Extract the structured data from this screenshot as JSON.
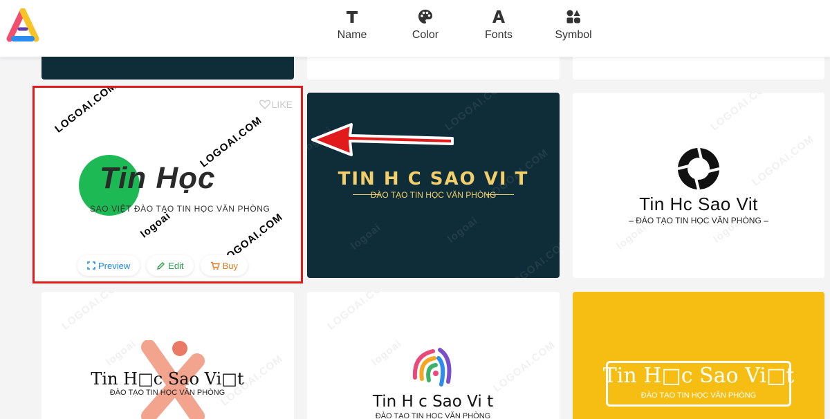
{
  "header": {
    "nav": [
      {
        "label": "Name",
        "icon": "text-icon"
      },
      {
        "label": "Color",
        "icon": "palette-icon"
      },
      {
        "label": "Fonts",
        "icon": "font-icon"
      },
      {
        "label": "Symbol",
        "icon": "shapes-icon"
      }
    ]
  },
  "watermark": {
    "text": "LOGOAI.COM",
    "brand": "logoai"
  },
  "selected_card": {
    "like_label": "LIKE",
    "logo_title": "Tin Học",
    "logo_subtitle": "SAO VIỆT ĐÀO TẠO TIN HỌC VĂN PHÒNG",
    "actions": {
      "preview": "Preview",
      "edit": "Edit",
      "buy": "Buy"
    }
  },
  "dark_card": {
    "title": "TIN H C SAO VI T",
    "subtitle": "ĐÀO TẠO TIN HỌC VĂN PHÒNG"
  },
  "right_card": {
    "title": "Tin Hc Sao Vit",
    "subtitle": "– ĐÀO TẠO TIN HỌC VĂN PHÒNG –"
  },
  "bottom_left": {
    "title": "Tin H□c Sao Vi□t",
    "subtitle": "ĐÀO TẠO TIN HỌC VĂN PHÒNG"
  },
  "bottom_middle": {
    "title": "Tin H  c Sao Vi  t",
    "subtitle": "ĐÀO TẠO TIN HỌC VĂN PHÒNG"
  },
  "bottom_right": {
    "title": "Tin H□c Sao Vi□t",
    "subtitle": "ĐÀO TẠO TIN HỌC VĂN PHÒNG"
  },
  "colors": {
    "highlight_border": "#e11b1b",
    "arrow": "#e11b1b",
    "dark_card_bg": "#0f2d38",
    "gold_text": "#f2cf6a",
    "green_circle": "#1db954",
    "yellow_card_bg": "#f6be12"
  }
}
